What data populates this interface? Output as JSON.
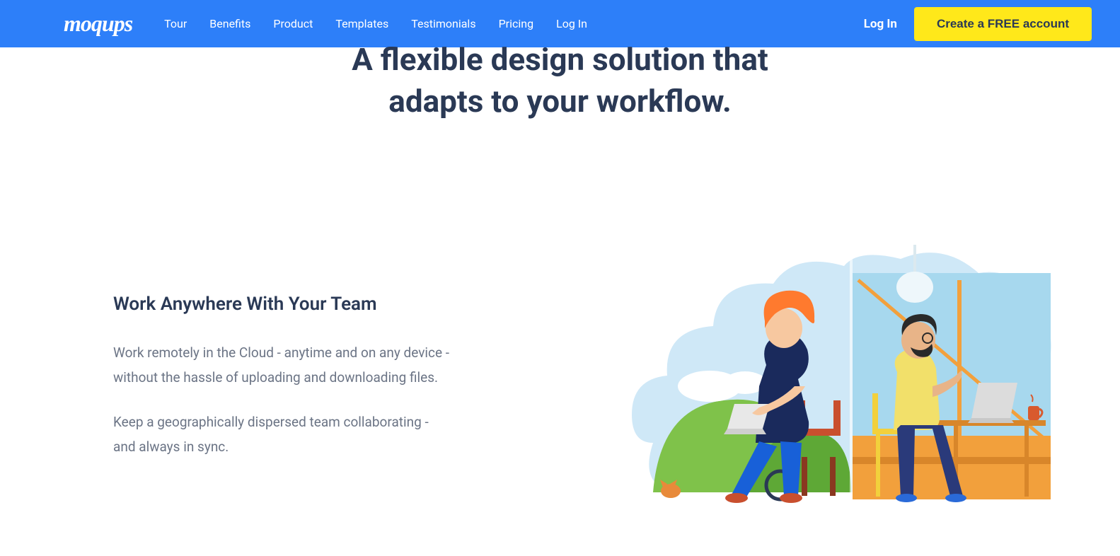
{
  "header": {
    "logo": "moqups",
    "nav": [
      "Tour",
      "Benefits",
      "Product",
      "Templates",
      "Testimonials",
      "Pricing",
      "Log In"
    ],
    "login": "Log In",
    "cta": "Create a FREE account"
  },
  "hero": {
    "line1": "A flexible design solution that",
    "line2": "adapts to your workflow."
  },
  "section": {
    "title": "Work Anywhere With Your Team",
    "p1": "Work remotely in the Cloud - anytime and on any device - without the hassle of uploading and downloading files.",
    "p2": "Keep a geographically dispersed team collaborating - and always in sync."
  },
  "colors": {
    "primary": "#2d7ff9",
    "accent": "#ffe81a",
    "text": "#2a3955",
    "muted": "#6b7485"
  }
}
